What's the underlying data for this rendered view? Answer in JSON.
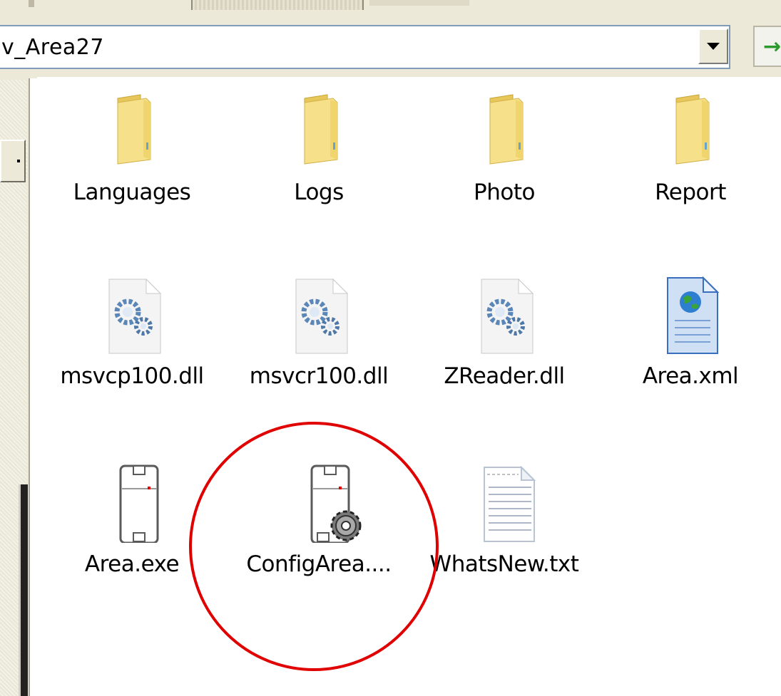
{
  "address_bar": {
    "path_text": "v_Area27"
  },
  "folders": [
    {
      "label": "Languages",
      "icon": "folder-icon"
    },
    {
      "label": "Logs",
      "icon": "folder-icon"
    },
    {
      "label": "Photo",
      "icon": "folder-icon"
    },
    {
      "label": "Report",
      "icon": "folder-icon"
    }
  ],
  "files": [
    {
      "label": "msvcp100.dll",
      "icon": "dll-file-icon"
    },
    {
      "label": "msvcr100.dll",
      "icon": "dll-file-icon"
    },
    {
      "label": "ZReader.dll",
      "icon": "dll-file-icon"
    },
    {
      "label": "Area.xml",
      "icon": "xml-file-icon"
    },
    {
      "label": "Area.exe",
      "icon": "exe-app-icon"
    },
    {
      "label": "ConfigArea....",
      "icon": "config-exe-icon"
    },
    {
      "label": "WhatsNew.txt",
      "icon": "text-file-icon"
    }
  ],
  "annotation": {
    "circle_color": "#e00000"
  },
  "colors": {
    "folder": "#f5dd7e",
    "window_bg": "#ece9d8",
    "address_border": "#7f9db9"
  }
}
